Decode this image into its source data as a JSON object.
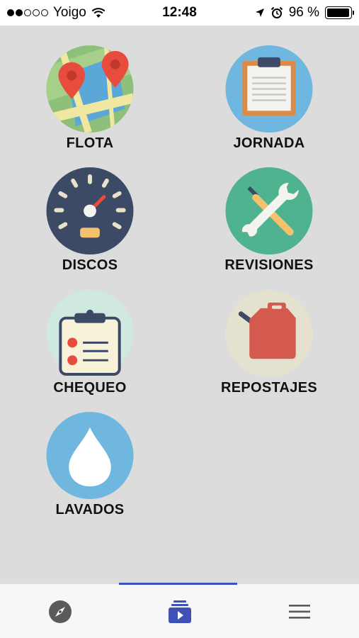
{
  "status_bar": {
    "carrier": "Yoigo",
    "time": "12:48",
    "battery_percent": "96 %",
    "battery_level": 0.96,
    "signal_bars": 2
  },
  "menu": {
    "items": [
      {
        "label": "FLOTA",
        "icon": "map-pin-icon"
      },
      {
        "label": "JORNADA",
        "icon": "clipboard-icon"
      },
      {
        "label": "DISCOS",
        "icon": "speedometer-icon"
      },
      {
        "label": "REVISIONES",
        "icon": "wrench-screwdriver-icon"
      },
      {
        "label": "CHEQUEO",
        "icon": "checklist-icon"
      },
      {
        "label": "REPOSTAJES",
        "icon": "fuel-can-icon"
      },
      {
        "label": "LAVADOS",
        "icon": "water-drop-icon"
      }
    ]
  },
  "tabbar": {
    "active_index": 1,
    "tabs": [
      {
        "icon": "compass-icon"
      },
      {
        "icon": "media-stack-icon"
      },
      {
        "icon": "hamburger-menu-icon"
      }
    ]
  },
  "colors": {
    "accent": "#3f51b5",
    "background": "#dcdcdc"
  }
}
